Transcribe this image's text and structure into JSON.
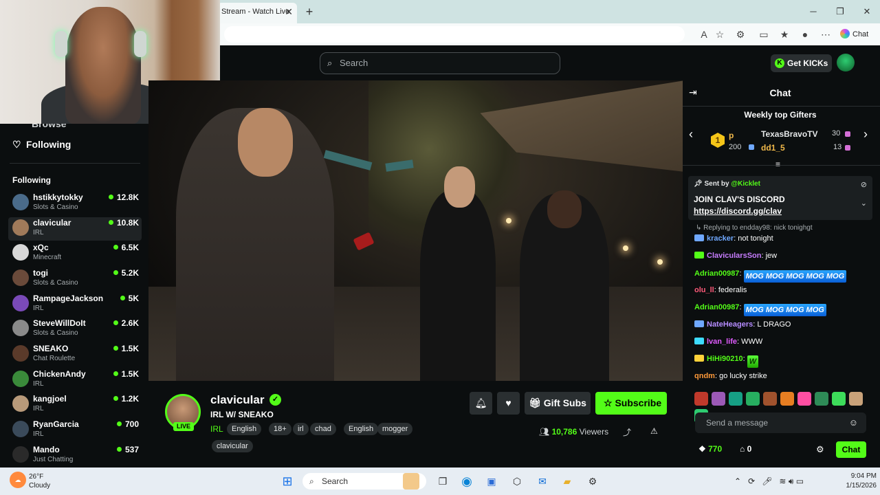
{
  "browser": {
    "tab_title": "Stream - Watch Live",
    "chat_button": "Chat"
  },
  "header": {
    "search_placeholder": "Search",
    "get_kicks": "Get KICKs"
  },
  "sidebar": {
    "partial_nav_label": "Browse",
    "following_nav": "Following",
    "section_title": "Following",
    "channels": [
      {
        "name": "hstikkytokky",
        "category": "Slots & Casino",
        "viewers": "12.8K",
        "color": "#4a6b8a"
      },
      {
        "name": "clavicular",
        "category": "IRL",
        "viewers": "10.8K",
        "color": "#a07a5a"
      },
      {
        "name": "xQc",
        "category": "Minecraft",
        "viewers": "6.5K",
        "color": "#d8d8d8"
      },
      {
        "name": "togi",
        "category": "Slots & Casino",
        "viewers": "5.2K",
        "color": "#6a4a3a"
      },
      {
        "name": "RampageJackson",
        "category": "IRL",
        "viewers": "5K",
        "color": "#7a4ab8"
      },
      {
        "name": "SteveWillDoIt",
        "category": "Slots & Casino",
        "viewers": "2.6K",
        "color": "#8a8a8a"
      },
      {
        "name": "SNEAKO",
        "category": "Chat Roulette",
        "viewers": "1.5K",
        "color": "#5a3a2a"
      },
      {
        "name": "ChickenAndy",
        "category": "IRL",
        "viewers": "1.5K",
        "color": "#3a8a3a"
      },
      {
        "name": "kangjoel",
        "category": "IRL",
        "viewers": "1.2K",
        "color": "#b89a7a"
      },
      {
        "name": "RyanGarcia",
        "category": "IRL",
        "viewers": "700",
        "color": "#3a4a5a"
      },
      {
        "name": "Mando",
        "category": "Just Chatting",
        "viewers": "537",
        "color": "#2a2a2a"
      }
    ]
  },
  "stream": {
    "name": "clavicular",
    "live": "LIVE",
    "title": "IRL W/ SNEAKO",
    "category": "IRL",
    "tags": [
      "English",
      "18+",
      "irl",
      "chad",
      "English",
      "mogger",
      "clavicular"
    ],
    "gift_subs": "Gift Subs",
    "subscribe": "Subscribe",
    "viewers_count": "10,786",
    "viewers_label": "Viewers"
  },
  "chat": {
    "title": "Chat",
    "gifters_title": "Weekly top Gifters",
    "gifters": [
      {
        "name": "p",
        "count": "200",
        "rank": "1"
      },
      {
        "name": "TexasBravoTV",
        "count": "30"
      },
      {
        "name": "dd1_5",
        "count": "13"
      }
    ],
    "pinned": {
      "sent_by": "Sent by",
      "author": "@Kicklet",
      "line1": "JOIN CLAV'S DISCORD",
      "line2": "https://discord.gg/clav"
    },
    "replying": "Replying to endday98: nick tonighgt",
    "messages": [
      {
        "user": "kracker",
        "text": "not tonight",
        "color": "#6fa8ff",
        "emote": "",
        "badge": "#6fa8ff"
      },
      {
        "user": "ClavicularsSon",
        "text": "jew",
        "color": "#c77dff",
        "emote": "",
        "badge": "#53fc18"
      },
      {
        "user": "Adrian00987",
        "text": "",
        "color": "#53fc18",
        "emote": "MOG MOG MOG MOG MOG",
        "badge": ""
      },
      {
        "user": "olu_ll",
        "text": "federalis",
        "color": "#ff5a7a",
        "emote": "",
        "badge": ""
      },
      {
        "user": "Adrian00987",
        "text": "",
        "color": "#53fc18",
        "emote": "MOG MOG MOG MOG",
        "badge": ""
      },
      {
        "user": "NateHeagers",
        "text": "L DRAGO",
        "color": "#b58cff",
        "emote": "",
        "badge": "#6fa8ff"
      },
      {
        "user": "lvan_life",
        "text": "WWW",
        "color": "#e05cff",
        "emote": "",
        "badge": "#3ddcff"
      },
      {
        "user": "HiHi90210",
        "text": "",
        "color": "#53fc18",
        "emote": "W",
        "badge": "#ffd23a"
      },
      {
        "user": "qndm",
        "text": "go lucky strike",
        "color": "#ff9a3a",
        "emote": "",
        "badge": ""
      }
    ],
    "input_placeholder": "Send a message",
    "kicks": "770",
    "subs": "0",
    "send": "Chat"
  },
  "taskbar": {
    "temp": "26°F",
    "weather": "Cloudy",
    "search": "Search",
    "time": "9:04 PM",
    "date": "1/15/2026"
  },
  "colors": {
    "accent": "#53fc18",
    "background": "#0b0e0f"
  }
}
